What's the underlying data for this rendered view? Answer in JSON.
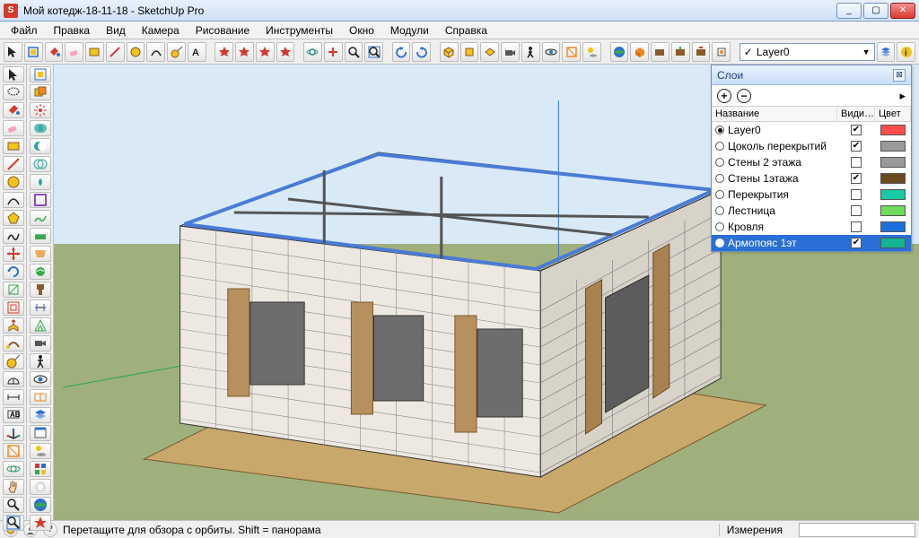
{
  "window": {
    "title": "Мой котедж-18-11-18 - SketchUp Pro",
    "app_letter": "S",
    "buttons": {
      "min": "_",
      "max": "▢",
      "close": "✕"
    }
  },
  "menu": [
    "Файл",
    "Правка",
    "Вид",
    "Камера",
    "Рисование",
    "Инструменты",
    "Окно",
    "Модули",
    "Справка"
  ],
  "toolbar_top": {
    "groups": [
      [
        "select",
        "make-component",
        "paint",
        "eraser",
        "rectangle",
        "line",
        "circle",
        "arc",
        "tape",
        "text"
      ],
      [
        "orbit",
        "pan",
        "zoom",
        "zoom-extents",
        "previous",
        "undo",
        "redo"
      ],
      [
        "plugin-a",
        "plugin-b",
        "plugin-c",
        "plugin-d"
      ],
      [
        "iso",
        "front",
        "top",
        "camera",
        "walk",
        "lookaround",
        "section",
        "shadows"
      ],
      [
        "earth",
        "3dwarehouse",
        "extensions",
        "sandbox-a",
        "sandbox-b",
        "sandbox-c"
      ]
    ],
    "layer_selected": "Layer0",
    "layer_checkmark": "✓"
  },
  "left_tool_columns": [
    [
      "select",
      "lasso",
      "paint",
      "eraser",
      "rectangle",
      "line",
      "circle",
      "arc",
      "polygon",
      "freehand",
      "move",
      "rotate",
      "scale",
      "offset",
      "pushpull",
      "followme",
      "tape",
      "protractor",
      "dimension",
      "text",
      "axes",
      "section",
      "orbit",
      "pan",
      "zoom",
      "zoom-extents"
    ],
    [
      "make-component",
      "group",
      "explode",
      "solid-union",
      "solid-subtract",
      "solid-trim",
      "solid-intersect",
      "outer-shell",
      "sandbox-contours",
      "sandbox-scratch",
      "sandbox-drape",
      "sandbox-smoove",
      "sandbox-stamp",
      "sandbox-flip",
      "add-detail",
      "position-camera",
      "walk",
      "look-around",
      "section-plane",
      "layers",
      "scenes",
      "shadows",
      "styles",
      "soften",
      "earth",
      "plugin-x"
    ]
  ],
  "layers_panel": {
    "title": "Слои",
    "add": "+",
    "remove": "−",
    "flyout": "▸",
    "columns": {
      "name": "Название",
      "visible": "Види…",
      "color": "Цвет"
    },
    "rows": [
      {
        "name": "Layer0",
        "active": true,
        "visible": true,
        "color": "#ff4d4d"
      },
      {
        "name": "Цоколь перекрытий",
        "active": false,
        "visible": true,
        "color": "#9a9a9a"
      },
      {
        "name": "Стены 2 этажа",
        "active": false,
        "visible": false,
        "color": "#9a9a9a"
      },
      {
        "name": "Стены 1этажа",
        "active": false,
        "visible": true,
        "color": "#6b4a1f"
      },
      {
        "name": "Перекрытия",
        "active": false,
        "visible": false,
        "color": "#19c9a6"
      },
      {
        "name": "Лестница",
        "active": false,
        "visible": false,
        "color": "#6fdc5c"
      },
      {
        "name": "Кровля",
        "active": false,
        "visible": false,
        "color": "#1d6fe0"
      },
      {
        "name": "Армопояс 1эт",
        "active": false,
        "visible": true,
        "color": "#12b58f",
        "selected": true
      }
    ]
  },
  "statusbar": {
    "help": "?",
    "hint": "Перетащите для обзора с орбиты.  Shift = панорама",
    "measure_label": "Измерения"
  },
  "icon_colors": {
    "red": "#d63a2e",
    "orange": "#f08a24",
    "yellow": "#f0c419",
    "green": "#3aa84f",
    "blue": "#2f6fd1",
    "teal": "#2aa7a0",
    "purple": "#8a4bd4",
    "gray": "#777",
    "brown": "#8a5a2b"
  }
}
